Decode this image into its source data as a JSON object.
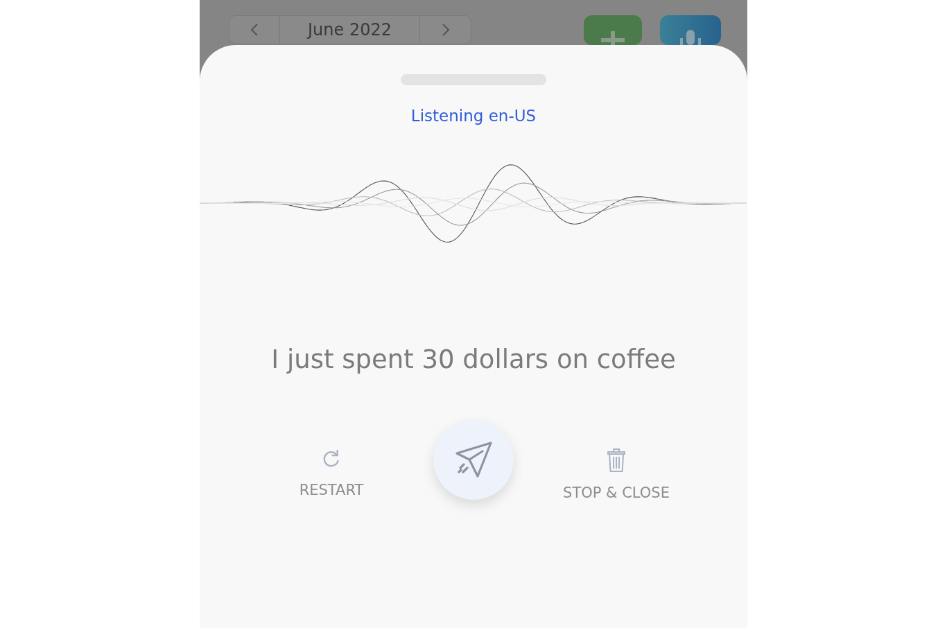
{
  "header": {
    "month": "June 2022"
  },
  "sheet": {
    "status": "Listening en-US",
    "transcript": "I just spent 30 dollars on coffee",
    "actions": [
      {
        "kind": "restart",
        "label": "RESTART"
      },
      {
        "kind": "send"
      },
      {
        "kind": "stop",
        "label": "STOP & CLOSE"
      }
    ]
  }
}
